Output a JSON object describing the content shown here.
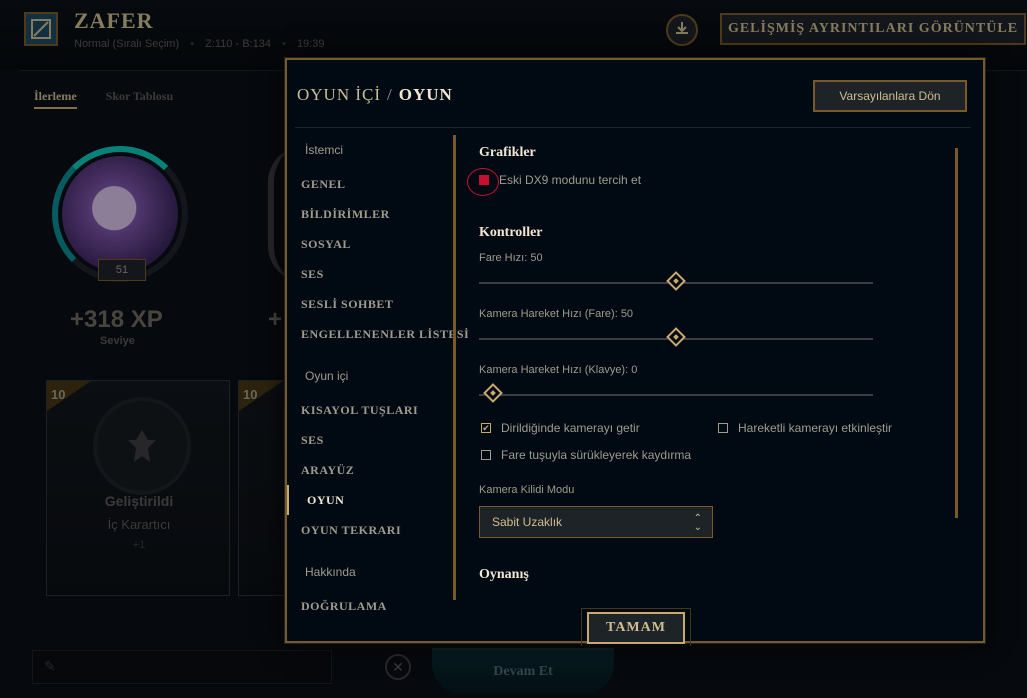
{
  "header": {
    "result": "ZAFER",
    "queue": "Normal (Sıralı Seçim)",
    "score": "Z:110 - B:134",
    "duration": "19:39",
    "details_button": "GELİŞMİŞ AYRINTILARI GÖRÜNTÜLE",
    "download_icon": "download-icon"
  },
  "bg_tabs": [
    "İlerleme",
    "Skor Tablosu"
  ],
  "progress": {
    "level": "51",
    "xp": "+318 XP",
    "xp_label": "Seviye",
    "xp2_partial": "+"
  },
  "cards": [
    {
      "level": "10",
      "title": "Geliştirildi",
      "subtitle": "İç Karartıcı",
      "plus": "+1"
    },
    {
      "level": "10"
    }
  ],
  "footer": {
    "continue": "Devam Et"
  },
  "modal": {
    "title_parent": "OYUN İÇİ",
    "title_separator": "/",
    "title_current": "OYUN",
    "reset_button": "Varsayılanlara Dön",
    "ok_button": "TAMAM",
    "nav": {
      "group_client": "İstemci",
      "genel": "GENEL",
      "bildirimler": "BİLDİRİMLER",
      "sosyal": "SOSYAL",
      "ses_client": "SES",
      "sesli_sohbet": "SESLİ SOHBET",
      "engellenenler": "ENGELLENENLER LİSTESİ",
      "group_ingame": "Oyun içi",
      "kisayol": "KISAYOL TUŞLARI",
      "ses_ingame": "SES",
      "arayuz": "ARAYÜZ",
      "oyun": "OYUN",
      "oyun_tekrari": "OYUN TEKRARI",
      "group_about": "Hakkında",
      "dogrulama": "DOĞRULAMA"
    },
    "graphics": {
      "title": "Grafikler",
      "dx9_label": "Eski DX9 modunu tercih et",
      "dx9_checked": false
    },
    "controls": {
      "title": "Kontroller",
      "mouse_speed_label": "Fare Hızı: 50",
      "mouse_speed": 50,
      "cam_mouse_label": "Kamera Hareket Hızı (Fare): 50",
      "cam_mouse": 50,
      "cam_keyboard_label": "Kamera Hareket Hızı (Klavye): 0",
      "cam_keyboard": 0,
      "respawn_label": "Dirildiğinde kamerayı getir",
      "respawn_checked": true,
      "moving_cam_label": "Hareketli kamerayı etkinleştir",
      "moving_cam_checked": false,
      "drag_scroll_label": "Fare tuşuyla sürükleyerek kaydırma",
      "drag_scroll_checked": false,
      "cam_lock_label": "Kamera Kilidi Modu",
      "cam_lock_value": "Sabit Uzaklık"
    },
    "gameplay": {
      "title": "Oynanış"
    }
  },
  "colors": {
    "gold": "#c8aa6e",
    "gold_dark": "#785a28",
    "text": "#a09b8c",
    "highlight": "#c8102e",
    "bg": "#010a13"
  }
}
